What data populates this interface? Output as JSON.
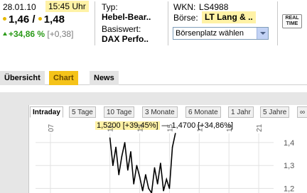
{
  "quote": {
    "date": "28.01.10",
    "time": "15:45 Uhr",
    "bid": "1,46",
    "slash": "/",
    "ask": "1,48",
    "change_pct": "+34,86 %",
    "change_abs": "[+0,38]",
    "typ_label": "Typ:",
    "typ_value": "Hebel-Bear..",
    "basiswert_label": "Basiswert:",
    "basiswert_value": "DAX Perfo..",
    "wkn_label": "WKN:",
    "wkn_value": "LS4988",
    "boerse_label": "Börse:",
    "boerse_value": "LT Lang & ..",
    "select_value": "Börsenplatz wählen",
    "realtime_icon": "real-time-icon",
    "realtime_line1": "REAL",
    "realtime_line2": "TIME"
  },
  "tabs": [
    {
      "label": "Übersicht",
      "active": false
    },
    {
      "label": "Chart",
      "active": true
    },
    {
      "label": "News",
      "active": false
    }
  ],
  "periods": [
    {
      "label": "Intraday",
      "active": true
    },
    {
      "label": "5 Tage",
      "active": false
    },
    {
      "label": "10 Tage",
      "active": false
    },
    {
      "label": "3 Monate",
      "active": false
    },
    {
      "label": "6 Monate",
      "active": false
    },
    {
      "label": "1 Jahr",
      "active": false
    },
    {
      "label": "5 Jahre",
      "active": false
    },
    {
      "label": "∞",
      "active": false
    }
  ],
  "overlay": {
    "high": "1,5200 [+39,45%]",
    "dash": "—",
    "last": "1,4700 [+34,86%]"
  },
  "colors": {
    "highlight": "#fff2a6",
    "active_tab": "#f5c319",
    "positive": "#2a9a18"
  },
  "chart_data": {
    "type": "line",
    "x_ticks": [
      "07",
      "11",
      "13",
      "15",
      "17",
      "19",
      "21"
    ],
    "y_ticks": [
      "1,4",
      "1,3",
      "1,2"
    ],
    "ylim": [
      1.18,
      1.44
    ],
    "grid": true,
    "series": [
      {
        "x": [
          11.0,
          11.2,
          11.4,
          11.6,
          11.8,
          12.0,
          12.2,
          12.4,
          12.6,
          12.8,
          13.0,
          13.2,
          13.4,
          13.6,
          13.8,
          14.0,
          14.2,
          14.4,
          14.6,
          14.8,
          15.0,
          15.2,
          15.4
        ],
        "values": [
          1.42,
          1.3,
          1.38,
          1.26,
          1.34,
          1.4,
          1.28,
          1.36,
          1.22,
          1.3,
          1.25,
          1.19,
          1.26,
          1.2,
          1.18,
          1.29,
          1.22,
          1.31,
          1.19,
          1.24,
          1.2,
          1.38,
          1.44
        ]
      }
    ]
  }
}
